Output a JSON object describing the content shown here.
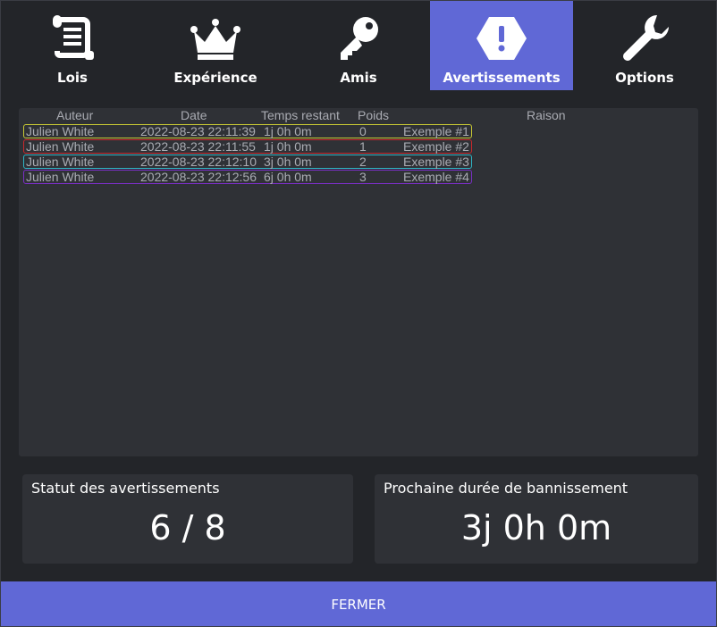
{
  "tabs": [
    {
      "label": "Lois",
      "icon": "scroll-icon"
    },
    {
      "label": "Expérience",
      "icon": "crown-icon"
    },
    {
      "label": "Amis",
      "icon": "key-icon"
    },
    {
      "label": "Avertissements",
      "icon": "warning-hexagon-icon",
      "active": true
    },
    {
      "label": "Options",
      "icon": "wrench-icon"
    }
  ],
  "warnings_table": {
    "headers": {
      "author": "Auteur",
      "date": "Date",
      "remaining": "Temps restant",
      "weight": "Poids",
      "reason": "Raison"
    },
    "rows": [
      {
        "author": "Julien White",
        "date": "2022-08-23 22:11:39",
        "remaining": "1j 0h 0m",
        "weight": "0",
        "reason": "Exemple #1",
        "color": "#c9c934"
      },
      {
        "author": "Julien White",
        "date": "2022-08-23 22:11:55",
        "remaining": "1j 0h 0m",
        "weight": "1",
        "reason": "Exemple #2",
        "color": "#c9282c"
      },
      {
        "author": "Julien White",
        "date": "2022-08-23 22:12:10",
        "remaining": "3j 0h 0m",
        "weight": "2",
        "reason": "Exemple #3",
        "color": "#2fb4c4"
      },
      {
        "author": "Julien White",
        "date": "2022-08-23 22:12:56",
        "remaining": "6j 0h 0m",
        "weight": "3",
        "reason": "Exemple #4",
        "color": "#7a2fc4"
      }
    ]
  },
  "warning_status": {
    "title": "Statut des avertissements",
    "value": "6 / 8"
  },
  "next_ban": {
    "title": "Prochaine durée de bannissement",
    "value": "3j 0h 0m"
  },
  "close_label": "FERMER",
  "colors": {
    "accent": "#6068d6",
    "background": "#232529",
    "panel": "#2f3136",
    "muted_text": "#a9abb2"
  }
}
